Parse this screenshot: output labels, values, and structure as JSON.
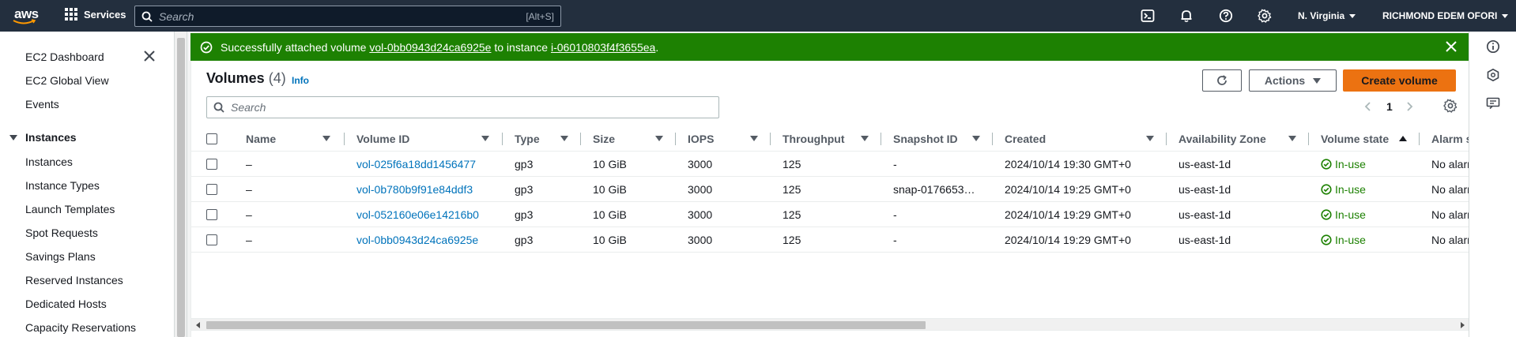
{
  "topnav": {
    "logo_text": "aws",
    "services_label": "Services",
    "search_placeholder": "Search",
    "search_shortcut": "[Alt+S]",
    "region": "N. Virginia",
    "account": "RICHMOND EDEM OFORI",
    "icons": [
      "cloudshell-icon",
      "bell-icon",
      "help-icon",
      "gear-icon"
    ]
  },
  "sidebar": {
    "top_items": [
      "EC2 Dashboard",
      "EC2 Global View",
      "Events"
    ],
    "section": "Instances",
    "section_items": [
      "Instances",
      "Instance Types",
      "Launch Templates",
      "Spot Requests",
      "Savings Plans",
      "Reserved Instances",
      "Dedicated Hosts",
      "Capacity Reservations"
    ]
  },
  "flash": {
    "prefix": "Successfully attached volume ",
    "volume": "vol-0bb0943d24ca6925e",
    "middle": " to instance ",
    "instance": "i-06010803f4f3655ea",
    "suffix": "."
  },
  "panel": {
    "title": "Volumes",
    "count": "(4)",
    "info": "Info",
    "refresh_icon": "refresh-icon",
    "actions_label": "Actions",
    "create_label": "Create volume",
    "search_placeholder": "Search",
    "page": "1"
  },
  "table": {
    "columns": [
      "Name",
      "Volume ID",
      "Type",
      "Size",
      "IOPS",
      "Throughput",
      "Snapshot ID",
      "Created",
      "Availability Zone",
      "Volume state",
      "Alarm s"
    ],
    "rows": [
      {
        "name": "–",
        "volume_id": "vol-025f6a18dd1456477",
        "type": "gp3",
        "size": "10 GiB",
        "iops": "3000",
        "throughput": "125",
        "snapshot": "-",
        "created": "2024/10/14 19:30 GMT+0",
        "az": "us-east-1d",
        "state": "In-use",
        "alarm": "No alarr"
      },
      {
        "name": "–",
        "volume_id": "vol-0b780b9f91e84ddf3",
        "type": "gp3",
        "size": "10 GiB",
        "iops": "3000",
        "throughput": "125",
        "snapshot": "snap-0176653…",
        "created": "2024/10/14 19:25 GMT+0",
        "az": "us-east-1d",
        "state": "In-use",
        "alarm": "No alarr"
      },
      {
        "name": "–",
        "volume_id": "vol-052160e06e14216b0",
        "type": "gp3",
        "size": "10 GiB",
        "iops": "3000",
        "throughput": "125",
        "snapshot": "-",
        "created": "2024/10/14 19:29 GMT+0",
        "az": "us-east-1d",
        "state": "In-use",
        "alarm": "No alarr"
      },
      {
        "name": "–",
        "volume_id": "vol-0bb0943d24ca6925e",
        "type": "gp3",
        "size": "10 GiB",
        "iops": "3000",
        "throughput": "125",
        "snapshot": "-",
        "created": "2024/10/14 19:29 GMT+0",
        "az": "us-east-1d",
        "state": "In-use",
        "alarm": "No alarr"
      }
    ]
  },
  "colors": {
    "nav_bg": "#232f3e",
    "success": "#1d8102",
    "primary": "#ec7211",
    "link": "#0073bb"
  }
}
